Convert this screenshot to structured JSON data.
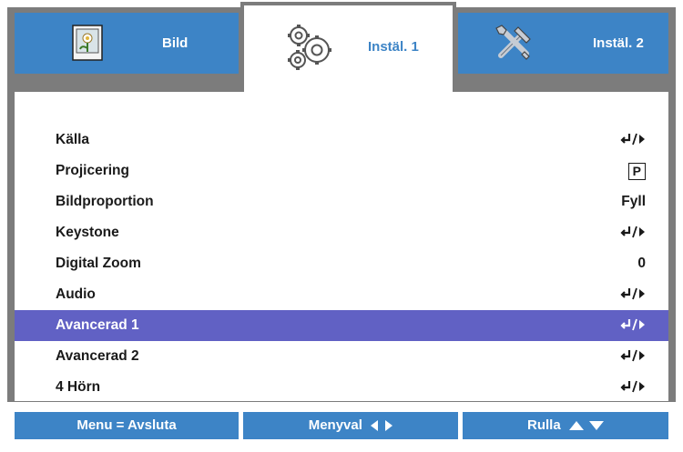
{
  "tabs": [
    {
      "label": "Bild",
      "icon": "picture-icon",
      "active": false
    },
    {
      "label": "Instäl. 1",
      "icon": "gears-icon",
      "active": true
    },
    {
      "label": "Instäl. 2",
      "icon": "tools-icon",
      "active": false
    }
  ],
  "menu": {
    "items": [
      {
        "label": "Källa",
        "value": "enter-arrow"
      },
      {
        "label": "Projicering",
        "value": "P"
      },
      {
        "label": "Bildproportion",
        "value": "Fyll"
      },
      {
        "label": "Keystone",
        "value": "enter-arrow"
      },
      {
        "label": "Digital Zoom",
        "value": "0"
      },
      {
        "label": "Audio",
        "value": "enter-arrow"
      },
      {
        "label": "Avancerad 1",
        "value": "enter-arrow",
        "selected": true
      },
      {
        "label": "Avancerad 2",
        "value": "enter-arrow"
      },
      {
        "label": "4 Hörn",
        "value": "enter-arrow"
      }
    ]
  },
  "footer": {
    "exit_label": "Menu = Avsluta",
    "nav_label": "Menyval",
    "scroll_label": "Rulla"
  },
  "colors": {
    "tab_blue": "#3d84c6",
    "frame_gray": "#7c7c7c",
    "highlight": "#6161c4"
  }
}
